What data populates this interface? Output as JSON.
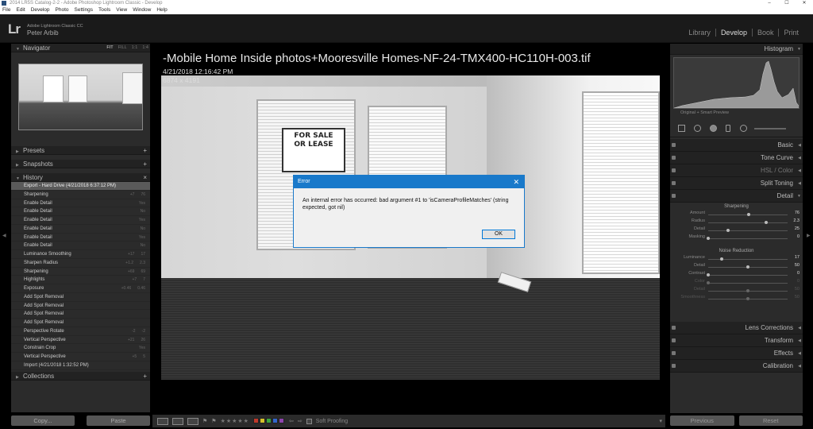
{
  "window": {
    "title": "2014 LR5S Catalog-2-2 - Adobe Photoshop Lightroom Classic - Develop",
    "controls": [
      "–",
      "☐",
      "✕"
    ]
  },
  "menu": [
    "File",
    "Edit",
    "Develop",
    "Photo",
    "Settings",
    "Tools",
    "View",
    "Window",
    "Help"
  ],
  "identity": {
    "logo": "Lr",
    "product": "Adobe Lightroom Classic CC",
    "user": "Peter Arbib"
  },
  "modules": [
    "Library",
    "Develop",
    "Book",
    "Print"
  ],
  "active_module": "Develop",
  "left_panel": {
    "navigator": {
      "title": "Navigator",
      "zoom": [
        "FIT",
        "FILL",
        "1:1",
        "1:4"
      ]
    },
    "presets": "Presets",
    "snapshots": "Snapshots",
    "history": {
      "title": "History",
      "items": [
        {
          "label": "Export - Hard Drive (4/21/2018 6:37:12 PM)",
          "a": "",
          "b": ""
        },
        {
          "label": "Sharpening",
          "a": "+7",
          "b": "76"
        },
        {
          "label": "Enable Detail",
          "a": "",
          "b": "Yes"
        },
        {
          "label": "Enable Detail",
          "a": "",
          "b": "No"
        },
        {
          "label": "Enable Detail",
          "a": "",
          "b": "Yes"
        },
        {
          "label": "Enable Detail",
          "a": "",
          "b": "No"
        },
        {
          "label": "Enable Detail",
          "a": "",
          "b": "Yes"
        },
        {
          "label": "Enable Detail",
          "a": "",
          "b": "No"
        },
        {
          "label": "Luminance Smoothing",
          "a": "+17",
          "b": "17"
        },
        {
          "label": "Sharpen Radius",
          "a": "+1.2",
          "b": "2.3"
        },
        {
          "label": "Sharpening",
          "a": "+69",
          "b": "69"
        },
        {
          "label": "Highlights",
          "a": "+7",
          "b": "7"
        },
        {
          "label": "Exposure",
          "a": "+0.46",
          "b": "0.46"
        },
        {
          "label": "Add Spot Removal",
          "a": "",
          "b": ""
        },
        {
          "label": "Add Spot Removal",
          "a": "",
          "b": ""
        },
        {
          "label": "Add Spot Removal",
          "a": "",
          "b": ""
        },
        {
          "label": "Add Spot Removal",
          "a": "",
          "b": ""
        },
        {
          "label": "Perspective Rotate",
          "a": "-2",
          "b": "-2"
        },
        {
          "label": "Vertical Perspective",
          "a": "+21",
          "b": "26"
        },
        {
          "label": "Constrain Crop",
          "a": "",
          "b": "Yes"
        },
        {
          "label": "Vertical Perspective",
          "a": "+5",
          "b": "5"
        },
        {
          "label": "Import (4/21/2018 1:32:52 PM)",
          "a": "",
          "b": ""
        }
      ]
    },
    "collections": "Collections",
    "copy_button": "Copy...",
    "paste_button": "Paste"
  },
  "photo": {
    "filename": "-Mobile Home Inside photos+Mooresville Homes-NF-24-TMX400-HC110H-003.tif",
    "date": "4/21/2018 12:16:42 PM",
    "dimensions": "6874 x 4191",
    "sign_line1": "FOR SALE",
    "sign_line2": "OR LEASE"
  },
  "dialog": {
    "title": "Error",
    "message": "An internal error has occurred: bad argument #1 to 'isCameraProfileMatches' (string expected, got nil)",
    "ok": "OK"
  },
  "right_panel": {
    "histogram": "Histogram",
    "preview_label": "Original + Smart Preview",
    "sections": [
      "Basic",
      "Tone Curve",
      "HSL / Color",
      "Split Toning",
      "Detail"
    ],
    "detail": {
      "sharpening": "Sharpening",
      "sliders1": [
        {
          "label": "Amount",
          "value": "76",
          "pos": 0.51
        },
        {
          "label": "Radius",
          "value": "2.3",
          "pos": 0.73
        },
        {
          "label": "Detail",
          "value": "25",
          "pos": 0.25
        },
        {
          "label": "Masking",
          "value": "0",
          "pos": 0.0
        }
      ],
      "noise": "Noise Reduction",
      "sliders2": [
        {
          "label": "Luminance",
          "value": "17",
          "pos": 0.17,
          "dim": false
        },
        {
          "label": "Detail",
          "value": "50",
          "pos": 0.5,
          "dim": false
        },
        {
          "label": "Contrast",
          "value": "0",
          "pos": 0.0,
          "dim": false
        },
        {
          "label": "Color",
          "value": "0",
          "pos": 0.0,
          "dim": true
        },
        {
          "label": "Detail",
          "value": "50",
          "pos": 0.5,
          "dim": true
        },
        {
          "label": "Smoothness",
          "value": "50",
          "pos": 0.5,
          "dim": true
        }
      ]
    },
    "lower_sections": [
      "Lens Corrections",
      "Transform",
      "Effects",
      "Calibration"
    ],
    "previous_button": "Previous",
    "reset_button": "Reset"
  },
  "toolbar": {
    "rating": "★★★★★",
    "soft_proofing": "Soft Proofing",
    "colors": [
      "#c0392b",
      "#d4c02a",
      "#3ca43c",
      "#3366cc",
      "#8e44ad"
    ]
  }
}
